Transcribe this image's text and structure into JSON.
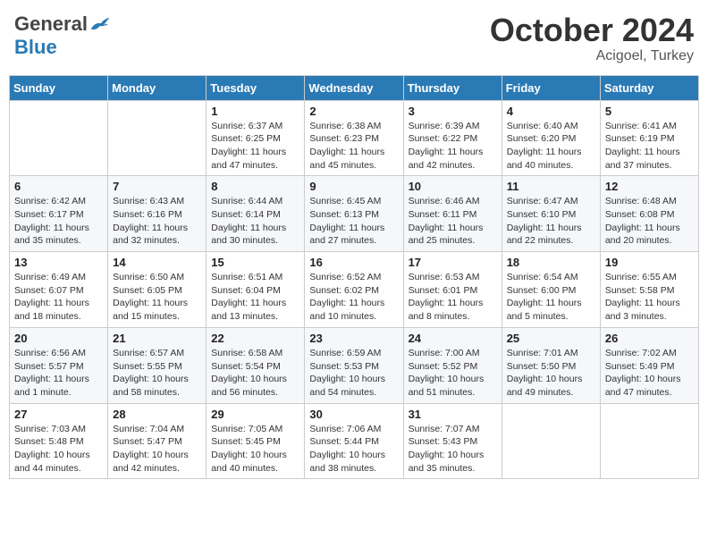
{
  "header": {
    "logo_general": "General",
    "logo_blue": "Blue",
    "month": "October 2024",
    "location": "Acigoel, Turkey"
  },
  "weekdays": [
    "Sunday",
    "Monday",
    "Tuesday",
    "Wednesday",
    "Thursday",
    "Friday",
    "Saturday"
  ],
  "weeks": [
    [
      {
        "day": "",
        "info": ""
      },
      {
        "day": "",
        "info": ""
      },
      {
        "day": "1",
        "info": "Sunrise: 6:37 AM\nSunset: 6:25 PM\nDaylight: 11 hours and 47 minutes."
      },
      {
        "day": "2",
        "info": "Sunrise: 6:38 AM\nSunset: 6:23 PM\nDaylight: 11 hours and 45 minutes."
      },
      {
        "day": "3",
        "info": "Sunrise: 6:39 AM\nSunset: 6:22 PM\nDaylight: 11 hours and 42 minutes."
      },
      {
        "day": "4",
        "info": "Sunrise: 6:40 AM\nSunset: 6:20 PM\nDaylight: 11 hours and 40 minutes."
      },
      {
        "day": "5",
        "info": "Sunrise: 6:41 AM\nSunset: 6:19 PM\nDaylight: 11 hours and 37 minutes."
      }
    ],
    [
      {
        "day": "6",
        "info": "Sunrise: 6:42 AM\nSunset: 6:17 PM\nDaylight: 11 hours and 35 minutes."
      },
      {
        "day": "7",
        "info": "Sunrise: 6:43 AM\nSunset: 6:16 PM\nDaylight: 11 hours and 32 minutes."
      },
      {
        "day": "8",
        "info": "Sunrise: 6:44 AM\nSunset: 6:14 PM\nDaylight: 11 hours and 30 minutes."
      },
      {
        "day": "9",
        "info": "Sunrise: 6:45 AM\nSunset: 6:13 PM\nDaylight: 11 hours and 27 minutes."
      },
      {
        "day": "10",
        "info": "Sunrise: 6:46 AM\nSunset: 6:11 PM\nDaylight: 11 hours and 25 minutes."
      },
      {
        "day": "11",
        "info": "Sunrise: 6:47 AM\nSunset: 6:10 PM\nDaylight: 11 hours and 22 minutes."
      },
      {
        "day": "12",
        "info": "Sunrise: 6:48 AM\nSunset: 6:08 PM\nDaylight: 11 hours and 20 minutes."
      }
    ],
    [
      {
        "day": "13",
        "info": "Sunrise: 6:49 AM\nSunset: 6:07 PM\nDaylight: 11 hours and 18 minutes."
      },
      {
        "day": "14",
        "info": "Sunrise: 6:50 AM\nSunset: 6:05 PM\nDaylight: 11 hours and 15 minutes."
      },
      {
        "day": "15",
        "info": "Sunrise: 6:51 AM\nSunset: 6:04 PM\nDaylight: 11 hours and 13 minutes."
      },
      {
        "day": "16",
        "info": "Sunrise: 6:52 AM\nSunset: 6:02 PM\nDaylight: 11 hours and 10 minutes."
      },
      {
        "day": "17",
        "info": "Sunrise: 6:53 AM\nSunset: 6:01 PM\nDaylight: 11 hours and 8 minutes."
      },
      {
        "day": "18",
        "info": "Sunrise: 6:54 AM\nSunset: 6:00 PM\nDaylight: 11 hours and 5 minutes."
      },
      {
        "day": "19",
        "info": "Sunrise: 6:55 AM\nSunset: 5:58 PM\nDaylight: 11 hours and 3 minutes."
      }
    ],
    [
      {
        "day": "20",
        "info": "Sunrise: 6:56 AM\nSunset: 5:57 PM\nDaylight: 11 hours and 1 minute."
      },
      {
        "day": "21",
        "info": "Sunrise: 6:57 AM\nSunset: 5:55 PM\nDaylight: 10 hours and 58 minutes."
      },
      {
        "day": "22",
        "info": "Sunrise: 6:58 AM\nSunset: 5:54 PM\nDaylight: 10 hours and 56 minutes."
      },
      {
        "day": "23",
        "info": "Sunrise: 6:59 AM\nSunset: 5:53 PM\nDaylight: 10 hours and 54 minutes."
      },
      {
        "day": "24",
        "info": "Sunrise: 7:00 AM\nSunset: 5:52 PM\nDaylight: 10 hours and 51 minutes."
      },
      {
        "day": "25",
        "info": "Sunrise: 7:01 AM\nSunset: 5:50 PM\nDaylight: 10 hours and 49 minutes."
      },
      {
        "day": "26",
        "info": "Sunrise: 7:02 AM\nSunset: 5:49 PM\nDaylight: 10 hours and 47 minutes."
      }
    ],
    [
      {
        "day": "27",
        "info": "Sunrise: 7:03 AM\nSunset: 5:48 PM\nDaylight: 10 hours and 44 minutes."
      },
      {
        "day": "28",
        "info": "Sunrise: 7:04 AM\nSunset: 5:47 PM\nDaylight: 10 hours and 42 minutes."
      },
      {
        "day": "29",
        "info": "Sunrise: 7:05 AM\nSunset: 5:45 PM\nDaylight: 10 hours and 40 minutes."
      },
      {
        "day": "30",
        "info": "Sunrise: 7:06 AM\nSunset: 5:44 PM\nDaylight: 10 hours and 38 minutes."
      },
      {
        "day": "31",
        "info": "Sunrise: 7:07 AM\nSunset: 5:43 PM\nDaylight: 10 hours and 35 minutes."
      },
      {
        "day": "",
        "info": ""
      },
      {
        "day": "",
        "info": ""
      }
    ]
  ]
}
